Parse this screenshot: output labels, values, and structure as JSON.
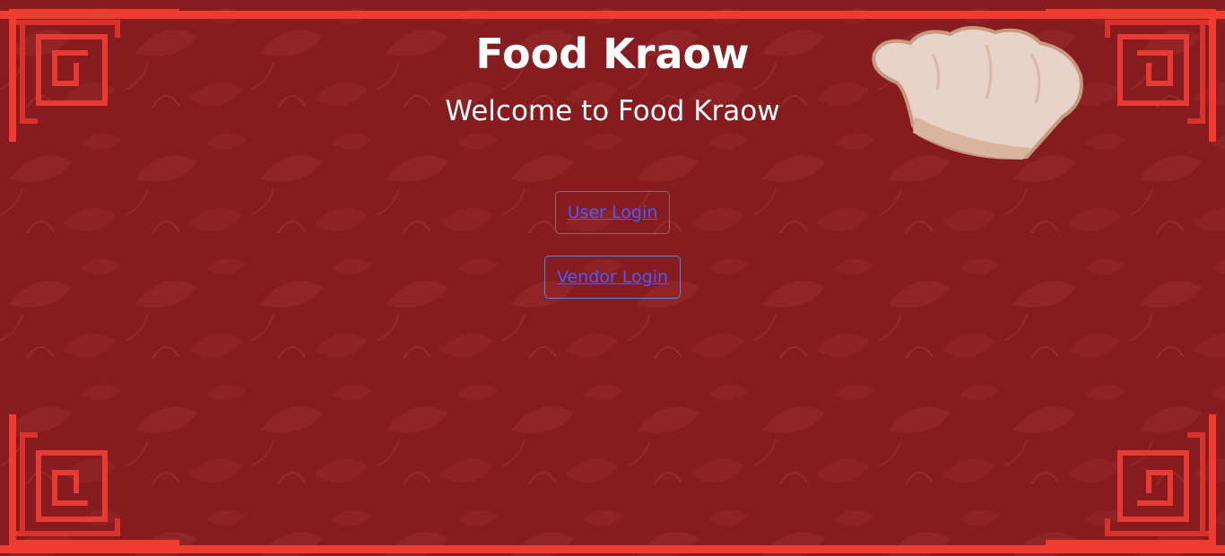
{
  "page": {
    "title": "Food Kraow",
    "subtitle": "Welcome to Food Kraow"
  },
  "actions": {
    "user_login": "User Login",
    "vendor_login": "Vendor Login"
  },
  "icons": {
    "chef_hat": "chef-hat-icon",
    "frame_corners": "chinese-lattice-corner-ornament"
  },
  "colors": {
    "background": "#861c1f",
    "frame": "#ef3b30",
    "link": "#4a5cff",
    "title_text": "#ffffff"
  }
}
